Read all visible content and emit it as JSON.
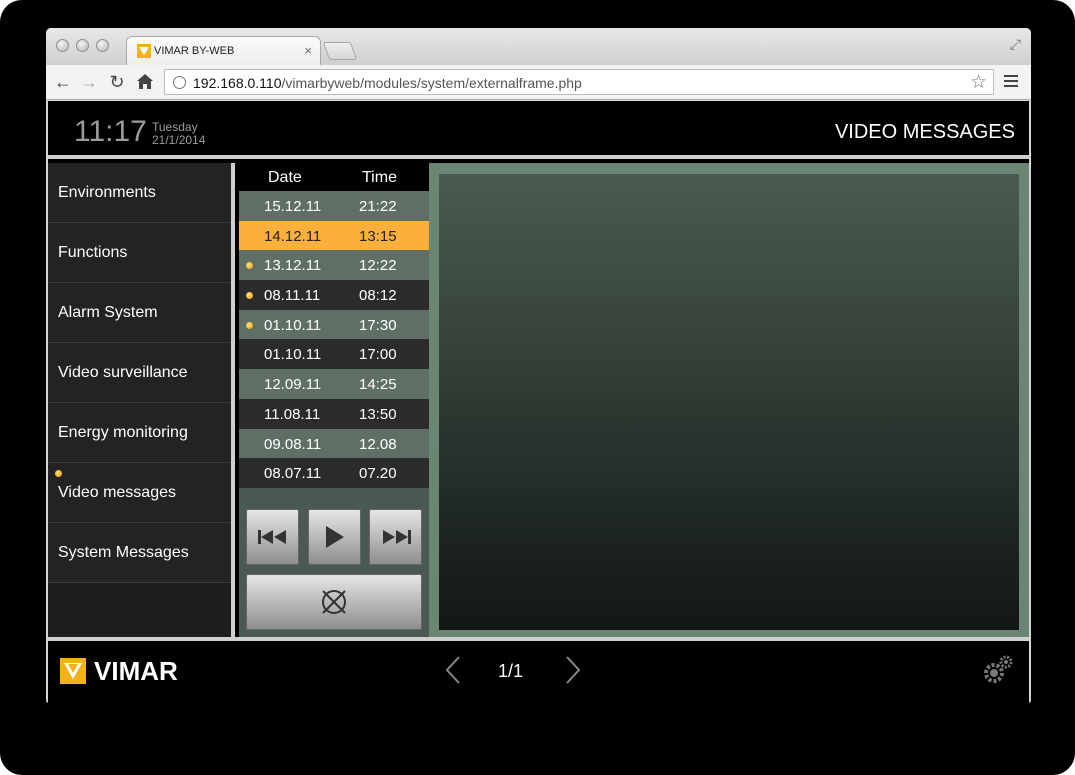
{
  "browser": {
    "tab_title": "VIMAR BY-WEB",
    "url_host": "192.168.0.110",
    "url_path": "/vimarbyweb/modules/system/externalframe.php"
  },
  "header": {
    "time": "11:17",
    "day": "Tuesday",
    "date": "21/1/2014",
    "title": "VIDEO MESSAGES"
  },
  "sidebar": {
    "items": [
      {
        "label": "Environments",
        "dot": false
      },
      {
        "label": "Functions",
        "dot": false
      },
      {
        "label": "Alarm System",
        "dot": false
      },
      {
        "label": "Video surveillance",
        "dot": false
      },
      {
        "label": "Energy monitoring",
        "dot": false
      },
      {
        "label": "Video messages",
        "dot": true
      },
      {
        "label": "System Messages",
        "dot": false
      }
    ]
  },
  "messages": {
    "columns": {
      "date": "Date",
      "time": "Time"
    },
    "rows": [
      {
        "date": "15.12.11",
        "time": "21:22",
        "new": false,
        "selected": false
      },
      {
        "date": "14.12.11",
        "time": "13:15",
        "new": false,
        "selected": true
      },
      {
        "date": "13.12.11",
        "time": "12:22",
        "new": true,
        "selected": false
      },
      {
        "date": "08.11.11",
        "time": "08:12",
        "new": true,
        "selected": false
      },
      {
        "date": "01.10.11",
        "time": "17:30",
        "new": true,
        "selected": false
      },
      {
        "date": "01.10.11",
        "time": "17:00",
        "new": false,
        "selected": false
      },
      {
        "date": "12.09.11",
        "time": "14:25",
        "new": false,
        "selected": false
      },
      {
        "date": "11.08.11",
        "time": "13:50",
        "new": false,
        "selected": false
      },
      {
        "date": "09.08.11",
        "time": "12.08",
        "new": false,
        "selected": false
      },
      {
        "date": "08.07.11",
        "time": "07.20",
        "new": false,
        "selected": false
      }
    ]
  },
  "footer": {
    "brand": "VIMAR",
    "pager": "1/1"
  },
  "icons": [
    "back-icon",
    "forward-icon",
    "reload-icon",
    "home-icon",
    "star-icon",
    "menu-icon",
    "skip-back-icon",
    "play-icon",
    "skip-forward-icon",
    "delete-icon",
    "prev-page-icon",
    "next-page-icon",
    "gear-icon"
  ],
  "colors": {
    "selected_row": "#fbb03b",
    "new_dot": "#f0a800",
    "panel_green": "#6b8574"
  }
}
